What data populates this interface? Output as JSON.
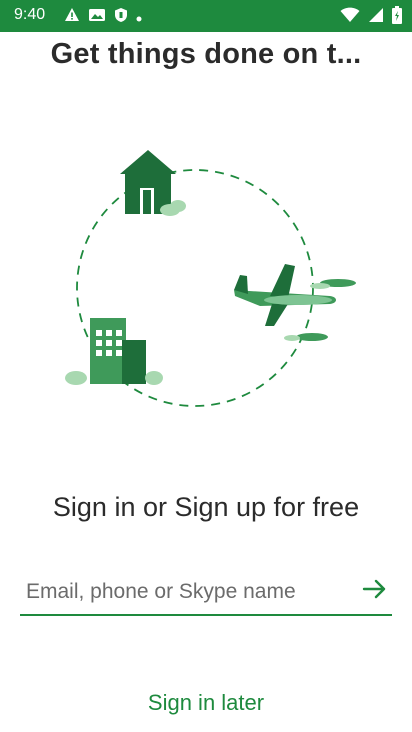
{
  "status_bar": {
    "time": "9:40",
    "left_icons": [
      "warning-icon",
      "image-icon",
      "shield-icon",
      "dot-icon"
    ],
    "right_icons": [
      "wifi-icon",
      "signal-icon",
      "battery-icon"
    ]
  },
  "onboarding": {
    "headline": "Get things done on t...",
    "illustration": "home-plane-office-cycle-illustration"
  },
  "signin": {
    "cta": "Sign in or Sign up for free",
    "input_placeholder": "Email, phone or Skype name",
    "input_value": "",
    "next_icon": "arrow-right-icon",
    "later_label": "Sign in later"
  },
  "colors": {
    "accent": "#1e8a3e",
    "status_bar": "#1e8a3e",
    "text": "#2b2b2b"
  }
}
